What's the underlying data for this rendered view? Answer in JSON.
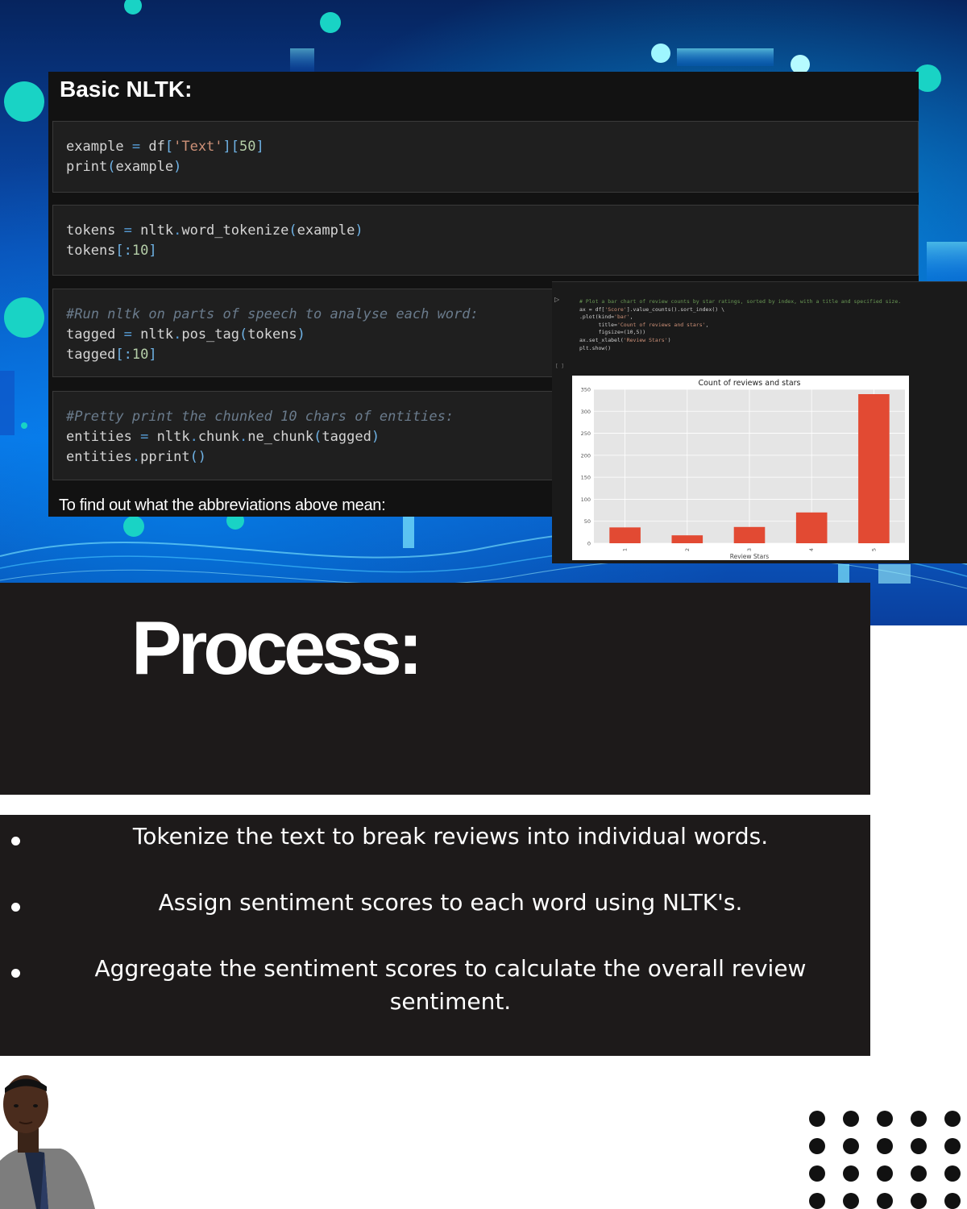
{
  "notebook": {
    "heading": "Basic NLTK:",
    "cells": [
      {
        "lines": [
          [
            [
              "t",
              "example "
            ],
            [
              "o",
              "="
            ],
            [
              "t",
              " df"
            ],
            [
              "p",
              "["
            ],
            [
              "s",
              "'Text'"
            ],
            [
              "p",
              "]["
            ],
            [
              "n",
              "50"
            ],
            [
              "p",
              "]"
            ]
          ],
          [
            [
              "t",
              "print"
            ],
            [
              "p",
              "("
            ],
            [
              "t",
              "example"
            ],
            [
              "p",
              ")"
            ]
          ]
        ]
      },
      {
        "lines": [
          [
            [
              "t",
              "tokens "
            ],
            [
              "o",
              "="
            ],
            [
              "t",
              " nltk"
            ],
            [
              "o",
              "."
            ],
            [
              "t",
              "word_tokenize"
            ],
            [
              "p",
              "("
            ],
            [
              "t",
              "example"
            ],
            [
              "p",
              ")"
            ]
          ],
          [
            [
              "t",
              "tokens"
            ],
            [
              "p",
              "[:"
            ],
            [
              "n",
              "10"
            ],
            [
              "p",
              "]"
            ]
          ]
        ]
      },
      {
        "lines": [
          [
            [
              "c",
              "#Run nltk on parts of speech to analyse each word:"
            ]
          ],
          [
            [
              "t",
              "tagged "
            ],
            [
              "o",
              "="
            ],
            [
              "t",
              " nltk"
            ],
            [
              "o",
              "."
            ],
            [
              "t",
              "pos_tag"
            ],
            [
              "p",
              "("
            ],
            [
              "t",
              "tokens"
            ],
            [
              "p",
              ")"
            ]
          ],
          [
            [
              "t",
              "tagged"
            ],
            [
              "p",
              "[:"
            ],
            [
              "n",
              "10"
            ],
            [
              "p",
              "]"
            ]
          ]
        ]
      },
      {
        "lines": [
          [
            [
              "c",
              "#Pretty print the chunked 10 chars of entities:"
            ]
          ],
          [
            [
              "t",
              "entities "
            ],
            [
              "o",
              "="
            ],
            [
              "t",
              " nltk"
            ],
            [
              "o",
              "."
            ],
            [
              "t",
              "chunk"
            ],
            [
              "o",
              "."
            ],
            [
              "t",
              "ne_chunk"
            ],
            [
              "p",
              "("
            ],
            [
              "t",
              "tagged"
            ],
            [
              "p",
              ")"
            ]
          ],
          [
            [
              "t",
              "entities"
            ],
            [
              "o",
              "."
            ],
            [
              "t",
              "pprint"
            ],
            [
              "p",
              "()"
            ]
          ]
        ]
      }
    ],
    "abbrev_text": "To find out what the abbreviations above mean:"
  },
  "chart_screenshot": {
    "code_lines": [
      [
        [
          "c",
          "# Plot a bar chart of review counts by star ratings, sorted by index, with a title and specified size."
        ]
      ],
      [
        [
          "t",
          "ax = df["
        ],
        [
          "s",
          "'Score'"
        ],
        [
          "t",
          "].value_counts().sort_index() \\"
        ]
      ],
      [
        [
          "t",
          ".plot(kind="
        ],
        [
          "s",
          "'bar'"
        ],
        [
          "t",
          ","
        ]
      ],
      [
        [
          "t",
          "      title="
        ],
        [
          "s",
          "'Count of reviews and stars'"
        ],
        [
          "t",
          ","
        ]
      ],
      [
        [
          "t",
          "      figsize=(10,5))"
        ]
      ],
      [
        [
          "t",
          "ax.set_xlabel("
        ],
        [
          "s",
          "'Review Stars'"
        ],
        [
          "t",
          ")"
        ]
      ],
      [
        [
          "t",
          "plt.show()"
        ]
      ]
    ],
    "run_icon": "play-icon",
    "cell_marker": "[ ]"
  },
  "chart_data": {
    "type": "bar",
    "title": "Count of reviews and stars",
    "xlabel": "Review Stars",
    "ylabel": "",
    "categories": [
      "1",
      "2",
      "3",
      "4",
      "5"
    ],
    "values": [
      36,
      18,
      37,
      70,
      339
    ],
    "ylim": [
      0,
      350
    ],
    "yticks": [
      0,
      50,
      100,
      150,
      200,
      250,
      300,
      350
    ],
    "grid": true,
    "bar_color": "#e24a33",
    "plot_bg": "#e5e5e5"
  },
  "process": {
    "title": "Process:",
    "bullets": [
      "Tokenize the text to break reviews into individual words.",
      "Assign sentiment scores to each word using NLTK's.",
      "Aggregate the sentiment scores to calculate the overall review sentiment."
    ]
  },
  "colors": {
    "panel_bg": "#121212",
    "process_bg": "#1d1a1a",
    "accent_cyan": "#19d3c5",
    "bg_blue": "#0b6fe0"
  }
}
